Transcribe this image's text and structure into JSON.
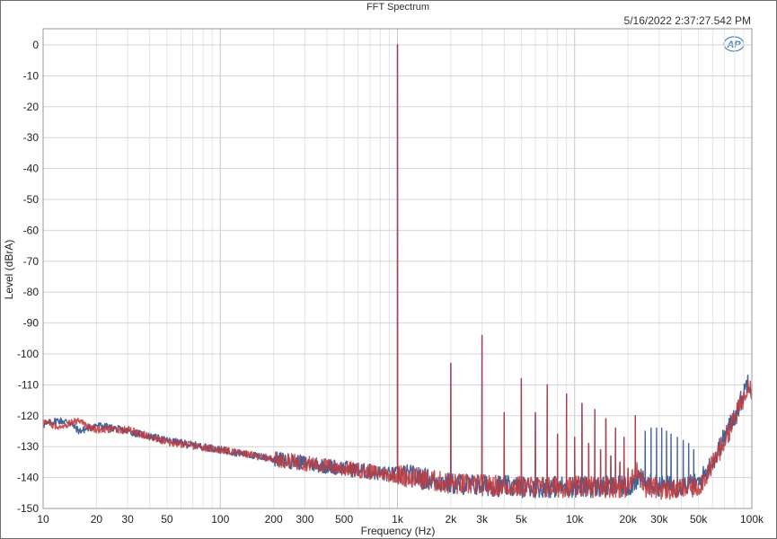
{
  "chart_data": {
    "type": "line",
    "title": "FFT Spectrum",
    "timestamp": "5/16/2022 2:37:27.542 PM",
    "logo_text": "AP",
    "xlabel": "Frequency (Hz)",
    "ylabel": "Level (dBrA)",
    "x_scale": "log",
    "xlim": [
      10,
      100000
    ],
    "ylim": [
      -150,
      0
    ],
    "grid": true,
    "x_ticks": [
      10,
      20,
      30,
      50,
      100,
      200,
      300,
      500,
      1000,
      2000,
      3000,
      5000,
      10000,
      20000,
      30000,
      50000,
      100000
    ],
    "x_tick_labels": [
      "10",
      "20",
      "30",
      "50",
      "100",
      "200",
      "300",
      "500",
      "1k",
      "2k",
      "3k",
      "5k",
      "10k",
      "20k",
      "30k",
      "50k",
      "100k"
    ],
    "y_ticks": [
      0,
      -10,
      -20,
      -30,
      -40,
      -50,
      -60,
      -70,
      -80,
      -90,
      -100,
      -110,
      -120,
      -130,
      -140,
      -150
    ],
    "y_tick_labels": [
      "0",
      "-10",
      "-20",
      "-30",
      "-40",
      "-50",
      "-60",
      "-70",
      "-80",
      "-90",
      "-100",
      "-110",
      "-120",
      "-130",
      "-140",
      "-150"
    ],
    "series": [
      {
        "color": "#3a5b94",
        "noise_floor": [
          [
            10,
            -123
          ],
          [
            12,
            -121.5
          ],
          [
            14,
            -122
          ],
          [
            16,
            -125
          ],
          [
            18,
            -124
          ],
          [
            20,
            -123
          ],
          [
            30,
            -125
          ],
          [
            50,
            -128
          ],
          [
            100,
            -131
          ],
          [
            200,
            -134
          ],
          [
            500,
            -137
          ],
          [
            900,
            -139
          ],
          [
            1100,
            -139
          ],
          [
            2000,
            -142
          ],
          [
            5000,
            -143
          ],
          [
            10000,
            -143
          ],
          [
            20000,
            -143
          ],
          [
            23000,
            -140
          ],
          [
            25000,
            -142
          ],
          [
            35000,
            -143
          ],
          [
            50000,
            -142
          ],
          [
            60000,
            -135
          ],
          [
            70000,
            -127
          ],
          [
            80000,
            -120
          ],
          [
            90000,
            -113
          ],
          [
            95000,
            -108
          ],
          [
            100000,
            -111
          ]
        ],
        "peaks": [
          [
            1000,
            0
          ],
          [
            2000,
            -103
          ],
          [
            3000,
            -94
          ],
          [
            4000,
            -119
          ],
          [
            5000,
            -108
          ],
          [
            6000,
            -119
          ],
          [
            7000,
            -110
          ],
          [
            8000,
            -126
          ],
          [
            9000,
            -113
          ],
          [
            10000,
            -127
          ],
          [
            11000,
            -116
          ],
          [
            12000,
            -129
          ],
          [
            13000,
            -118
          ],
          [
            14000,
            -131
          ],
          [
            15000,
            -121
          ],
          [
            16000,
            -133
          ],
          [
            17000,
            -124
          ],
          [
            18000,
            -135
          ],
          [
            19000,
            -127
          ],
          [
            20000,
            -137
          ],
          [
            22000,
            -120
          ],
          [
            25000,
            -125
          ],
          [
            27000,
            -124
          ],
          [
            29000,
            -124
          ],
          [
            31000,
            -124
          ],
          [
            33000,
            -125
          ],
          [
            35000,
            -126
          ],
          [
            38000,
            -127
          ],
          [
            41000,
            -128
          ],
          [
            44000,
            -129
          ],
          [
            47000,
            -131
          ]
        ]
      },
      {
        "color": "#c0393c",
        "noise_floor": [
          [
            10,
            -122
          ],
          [
            12,
            -123.5
          ],
          [
            14,
            -122.5
          ],
          [
            16,
            -121.5
          ],
          [
            18,
            -123.5
          ],
          [
            20,
            -124.5
          ],
          [
            30,
            -124.5
          ],
          [
            50,
            -128.5
          ],
          [
            100,
            -131
          ],
          [
            200,
            -134
          ],
          [
            500,
            -137
          ],
          [
            900,
            -139
          ],
          [
            1100,
            -139.5
          ],
          [
            2000,
            -142
          ],
          [
            5000,
            -143
          ],
          [
            10000,
            -143
          ],
          [
            20000,
            -143
          ],
          [
            23000,
            -137
          ],
          [
            25000,
            -143
          ],
          [
            35000,
            -144
          ],
          [
            50000,
            -143
          ],
          [
            60000,
            -136
          ],
          [
            70000,
            -128
          ],
          [
            80000,
            -121
          ],
          [
            90000,
            -114
          ],
          [
            95000,
            -109
          ],
          [
            100000,
            -112
          ]
        ],
        "peaks": [
          [
            1000,
            0
          ],
          [
            2000,
            -103
          ],
          [
            3000,
            -94
          ],
          [
            4000,
            -119
          ],
          [
            5000,
            -108
          ],
          [
            6000,
            -119
          ],
          [
            7000,
            -110
          ],
          [
            8000,
            -126
          ],
          [
            9000,
            -113
          ],
          [
            10000,
            -127
          ],
          [
            11000,
            -116
          ],
          [
            12000,
            -129
          ],
          [
            13000,
            -118
          ],
          [
            14000,
            -131
          ],
          [
            15000,
            -121
          ],
          [
            16000,
            -133
          ],
          [
            17000,
            -124
          ],
          [
            18000,
            -135
          ],
          [
            19000,
            -127
          ],
          [
            20000,
            -137
          ],
          [
            22000,
            -120
          ]
        ]
      }
    ]
  }
}
